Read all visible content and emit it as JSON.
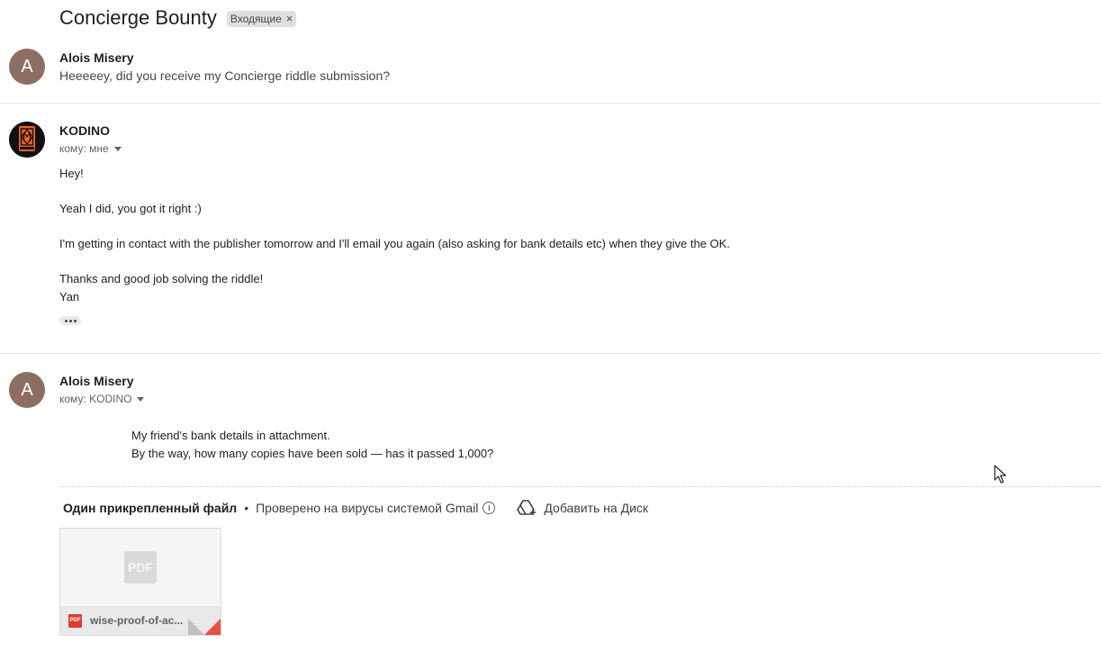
{
  "thread": {
    "subject": "Concierge Bounty",
    "label": "Входящие",
    "label_remove": "×"
  },
  "messages": [
    {
      "avatar_letter": "A",
      "sender": "Alois Misery",
      "snippet": "Heeeeey, did you receive my Concierge riddle submission?"
    },
    {
      "sender": "KODINO",
      "recipient": "кому: мне",
      "avatar_icon": "kodino-logo-icon",
      "body": [
        "Hey!",
        "Yeah I did, you got it right :)",
        "I'm getting in contact with the publisher tomorrow and I'll email you again (also asking for bank details etc) when they give the OK.",
        "Thanks and good job solving the riddle!",
        "Yan"
      ]
    },
    {
      "avatar_letter": "A",
      "sender": "Alois Misery",
      "recipient": "кому: KODINO",
      "body": [
        "My friend's bank details in attachment.",
        "By the way, how many copies have been sold — has it passed 1,000?"
      ]
    }
  ],
  "attachments": {
    "count_label": "Один прикрепленный файл",
    "bullet": "•",
    "scan_note": "Проверено на вирусы системой Gmail",
    "add_to_drive": "Добавить на Диск",
    "files": [
      {
        "name": "wise-proof-of-ac...",
        "type_label": "PDF"
      }
    ]
  },
  "colors": {
    "avatar_bg": "#8d6e63",
    "pdf_red": "#db3d2f",
    "corner_accent": "#e8503a"
  }
}
